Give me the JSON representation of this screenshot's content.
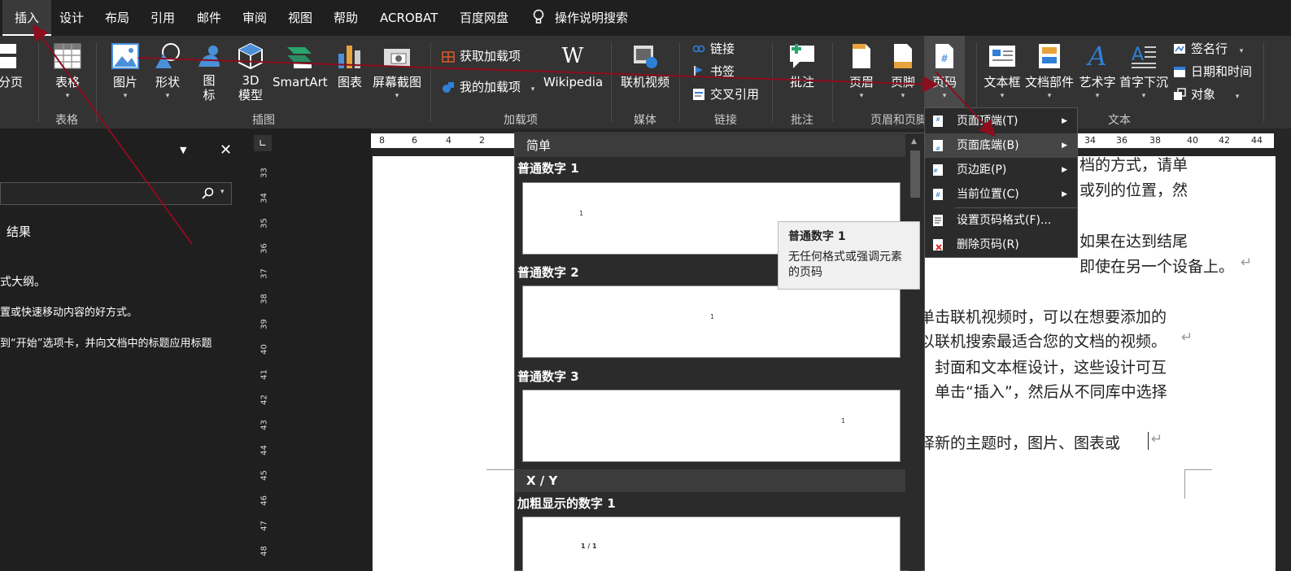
{
  "tabs": [
    {
      "label": "插入",
      "active": true
    },
    {
      "label": "设计"
    },
    {
      "label": "布局"
    },
    {
      "label": "引用"
    },
    {
      "label": "邮件"
    },
    {
      "label": "审阅"
    },
    {
      "label": "视图"
    },
    {
      "label": "帮助"
    },
    {
      "label": "ACROBAT"
    },
    {
      "label": "百度网盘"
    }
  ],
  "tell_me": "操作说明搜索",
  "ribbon": {
    "page_break": "分页",
    "table": "表格",
    "picture": "图片",
    "shapes": "形状",
    "icons_line1": "图",
    "icons_line2": "标",
    "model3d_line1": "3D",
    "model3d_line2": "模型",
    "smartart": "SmartArt",
    "chart": "图表",
    "screenshot": "屏幕截图",
    "get_addins": "获取加载项",
    "my_addins": "我的加载项",
    "wikipedia": "Wikipedia",
    "online_video": "联机视频",
    "link": "链接",
    "bookmark": "书签",
    "cross_ref": "交叉引用",
    "comment": "批注",
    "header": "页眉",
    "footer": "页脚",
    "page_number": "页码",
    "textbox": "文本框",
    "quick_parts": "文档部件",
    "wordart": "艺术字",
    "dropcap": "首字下沉",
    "signature": "签名行",
    "datetime": "日期和时间",
    "object": "对象",
    "groups": {
      "tables": "表格",
      "illustrations": "插图",
      "addins": "加载项",
      "media": "媒体",
      "links": "链接",
      "comments": "批注",
      "header_footer": "页眉和页脚",
      "text": "文本"
    }
  },
  "navpane": {
    "results": "结果",
    "line1": "式大纲。",
    "line2": "置或快速移动内容的好方式。",
    "line3": "到“开始”选项卡，并向文档中的标题应用标题"
  },
  "ruler": {
    "vertical": [
      "33",
      "34",
      "35",
      "36",
      "37",
      "38",
      "39",
      "40",
      "41",
      "42",
      "43",
      "44",
      "45",
      "46",
      "47",
      "48"
    ],
    "horizontal_left": [
      "8",
      "6",
      "4",
      "2"
    ],
    "horizontal_right": [
      "34",
      "36",
      "38",
      "40",
      "42",
      "44"
    ]
  },
  "document": {
    "lines": [
      "档的方式，请单",
      "或列的位置，然",
      "如果在达到结尾",
      "即使在另一个设备上。",
      "单击联机视频时，可以在想要添加的",
      "以联机搜索最适合您的文档的视频。",
      "、封面和文本框设计，这些设计可互",
      "，单击“插入”，然后从不同库中选择",
      "择新的主题时，图片、图表或"
    ]
  },
  "gallery": {
    "section_simple": "简单",
    "item1": "普通数字 1",
    "item2": "普通数字 2",
    "item3": "普通数字 3",
    "section_xy": "X / Y",
    "item4": "加粗显示的数字 1",
    "thumb1": "1",
    "thumb2": "1",
    "thumb3": "1",
    "thumb4": "1 / 1"
  },
  "tooltip": {
    "title": "普通数字 1",
    "desc": "无任何格式或强调元素的页码"
  },
  "submenu": {
    "top": "页面顶端(T)",
    "bottom": "页面底端(B)",
    "margins": "页边距(P)",
    "current": "当前位置(C)",
    "format": "设置页码格式(F)...",
    "remove": "删除页码(R)"
  },
  "colors": {
    "annotation": "#8b0d1e",
    "ribbon_bg": "#333333",
    "tabbar_bg": "#1f1f1f"
  }
}
